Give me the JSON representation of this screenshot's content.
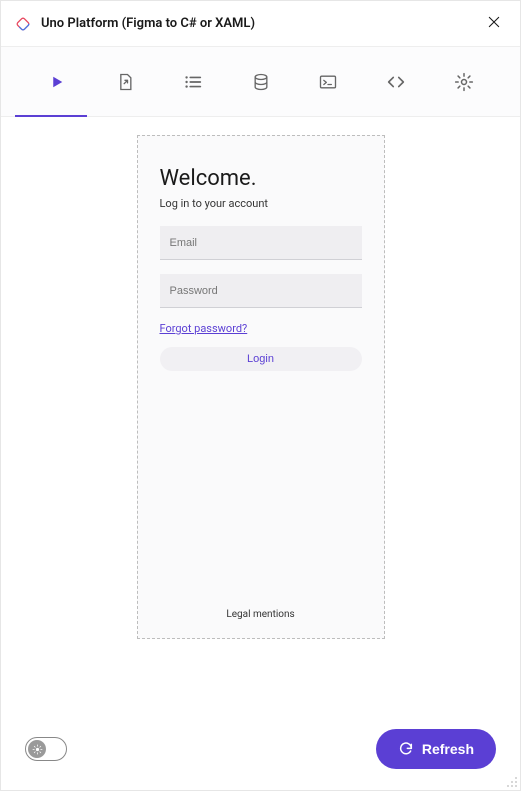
{
  "header": {
    "title": "Uno Platform (Figma to C# or XAML)"
  },
  "preview": {
    "welcome": "Welcome.",
    "subtitle": "Log in to your account",
    "email_placeholder": "Email",
    "password_placeholder": "Password",
    "forgot": "Forgot password?",
    "login_label": "Login",
    "legal": "Legal mentions"
  },
  "footer": {
    "refresh_label": "Refresh"
  },
  "colors": {
    "accent": "#5b3fd4"
  }
}
